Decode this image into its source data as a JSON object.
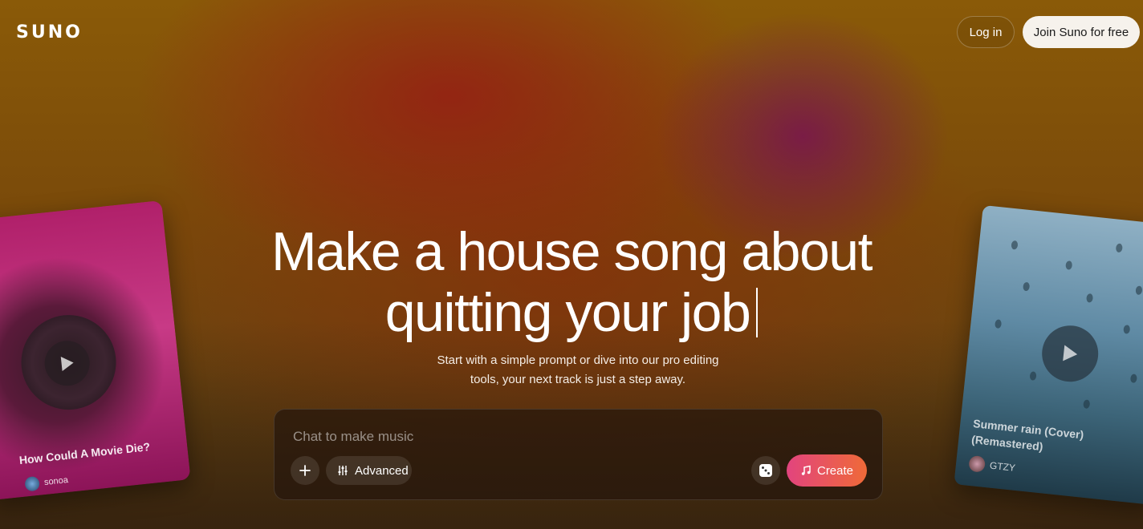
{
  "header": {
    "logo": "SUNO",
    "login_label": "Log in",
    "join_label": "Join Suno for free"
  },
  "hero": {
    "line1": "Make a house song about",
    "line2": "quitting your job",
    "subtitle_line1": "Start with a simple prompt or dive into our pro editing",
    "subtitle_line2": "tools, your next track is just a step away."
  },
  "chat": {
    "placeholder": "Chat to make music",
    "value": "",
    "plus_label": "+",
    "advanced_label": "Advanced",
    "create_label": "Create",
    "create_gradient": [
      "#e2447e",
      "#ef6a38"
    ]
  },
  "cards": {
    "left": {
      "title": "How Could A Movie Die?",
      "artist": "sonoa",
      "color": "#c83a86"
    },
    "right": {
      "title": "Summer rain (Cover) (Remastered)",
      "artist": "GTZY",
      "color": "#5f8aa4"
    }
  },
  "icons": {
    "plus": "plus-icon",
    "advanced": "sliders-icon",
    "dice": "dice-icon",
    "create": "music-note-icon",
    "play": "play-icon"
  }
}
